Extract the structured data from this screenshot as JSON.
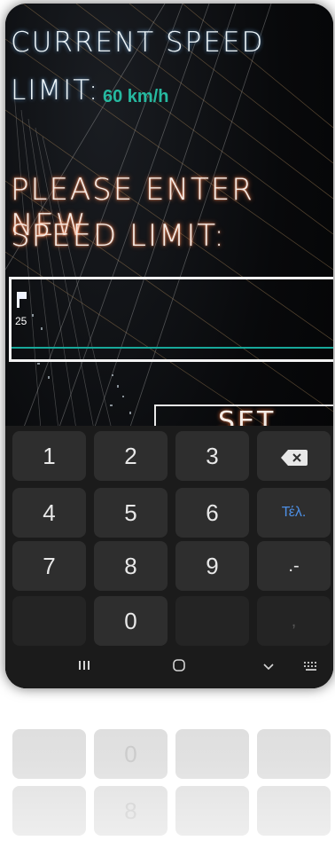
{
  "screen": {
    "current_speed_line1": "CURRENT SPEED",
    "current_speed_line2": "LIMIT:",
    "current_speed_value": "60 km/h",
    "new_speed_line1": "PLEASE ENTER NEW",
    "new_speed_line2": "SPEED LIMIT:",
    "input_value": "25",
    "set_button_label": "SET"
  },
  "keyboard": {
    "keys": [
      "1",
      "2",
      "3",
      "4",
      "5",
      "6",
      "7",
      "8",
      "9",
      "0"
    ],
    "done_label": "Τέλ.",
    "symbol_label": ".-",
    "comma_label": ",",
    "backspace_icon": "backspace-icon"
  },
  "navbar": {
    "recents_icon": "recents-icon",
    "home_icon": "home-icon",
    "back_icon": "chevron-down-icon",
    "keyboard_icon": "keyboard-icon"
  },
  "colors": {
    "accent": "#26b9a0",
    "done_blue": "#4d8fe5",
    "keyboard_bg": "#1b1b1b",
    "key_bg": "#2e2e2e"
  }
}
